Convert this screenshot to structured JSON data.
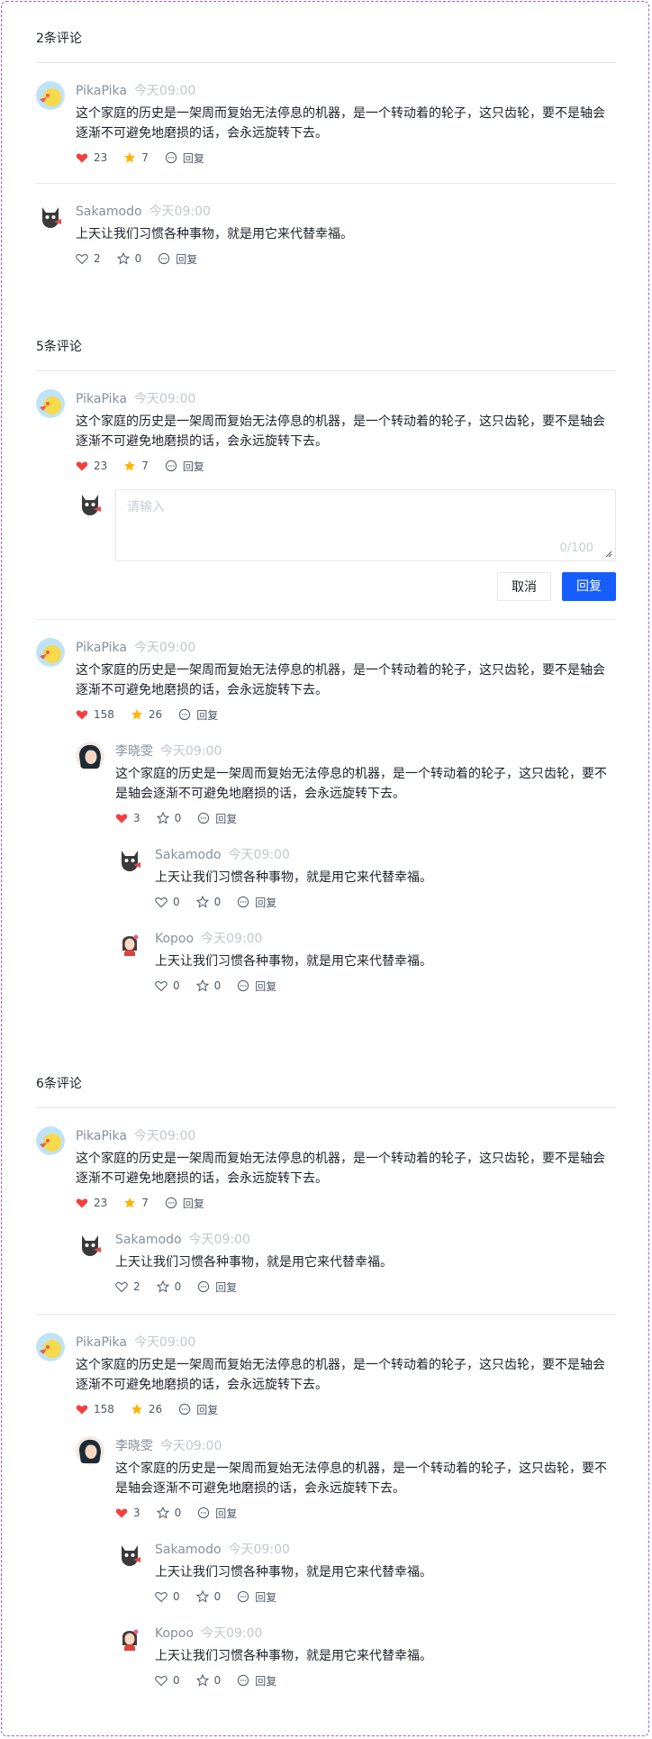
{
  "reply_label": "回复",
  "sections": [
    {
      "title": "2条评论"
    },
    {
      "title": "5条评论"
    },
    {
      "title": "6条评论"
    }
  ],
  "common": {
    "pika_name": "PikaPika",
    "time": "今天09:00",
    "long_text": "这个家庭的历史是一架周而复始无法停息的机器，是一个转动着的轮子，这只齿轮，要不是轴会逐渐不可避免地磨损的话，会永远旋转下去。",
    "saka_name": "Sakamodo",
    "short_text": "上天让我们习惯各种事物，就是用它来代替幸福。",
    "li_name": "李晓雯",
    "kopoo_name": "Kopoo"
  },
  "counts": {
    "c23": "23",
    "c7": "7",
    "c2": "2",
    "c0": "0",
    "c158": "158",
    "c26": "26",
    "c3": "3"
  },
  "reply_box": {
    "placeholder": "请输入",
    "counter": "0/100",
    "cancel_label": "取消",
    "submit_label": "回复"
  },
  "colors": {
    "accent": "#165dff",
    "heart": "#f53f3f",
    "star": "#ffb400",
    "border": "#e5e6eb"
  }
}
